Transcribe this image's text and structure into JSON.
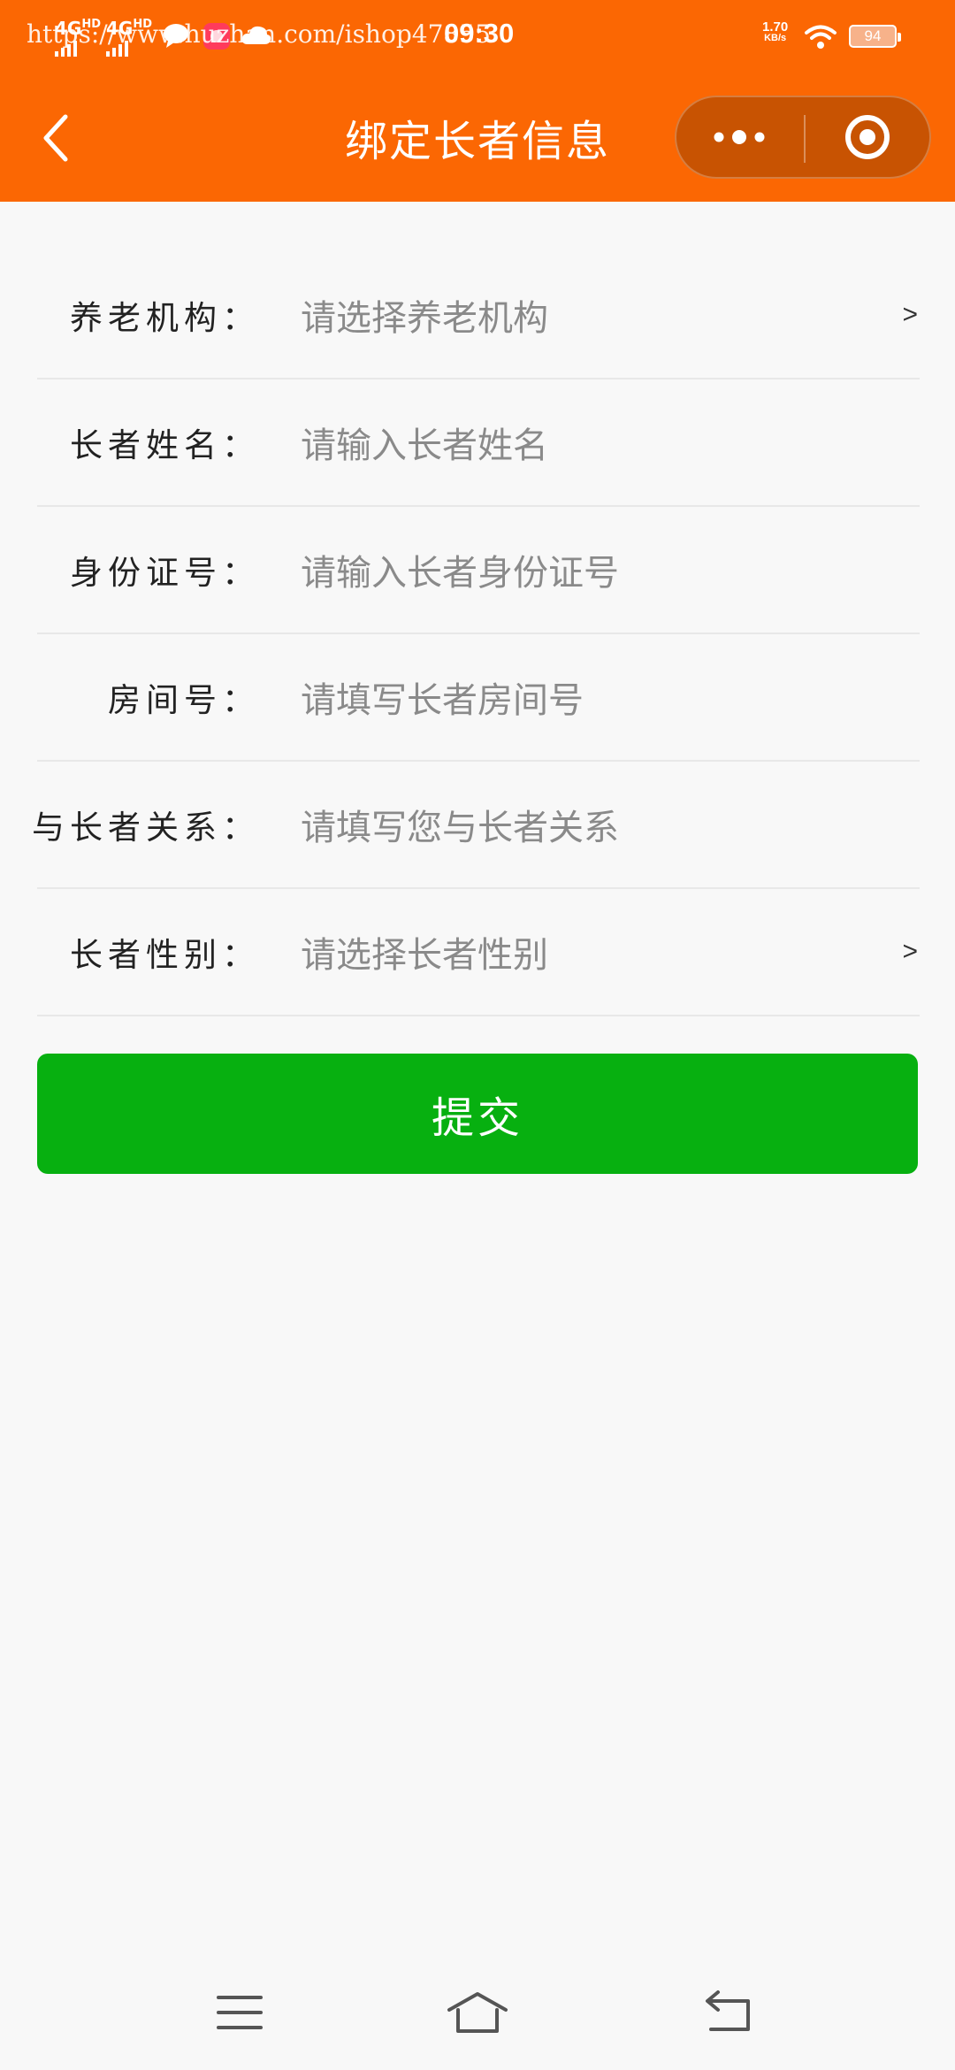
{
  "status_bar": {
    "network_1": "4G",
    "network_1_sup": "HD",
    "network_2": "4G",
    "network_2_sup": "HD",
    "watermark": "https://www.huzhan.com/ishop47855",
    "time": "09:30",
    "net_speed_value": "1.70",
    "net_speed_unit": "KB/s",
    "battery_level": "94"
  },
  "navbar": {
    "title": "绑定长者信息",
    "back_icon": "chevron-left-icon",
    "more_icon": "more-dots-icon",
    "close_icon": "target-circle-icon"
  },
  "form": {
    "rows": [
      {
        "label": "养老机构：",
        "placeholder": "请选择养老机构",
        "chevron": ">"
      },
      {
        "label": "长者姓名：",
        "placeholder": "请输入长者姓名"
      },
      {
        "label": "身份证号：",
        "placeholder": "请输入长者身份证号"
      },
      {
        "label": "房间号：",
        "placeholder": "请填写长者房间号"
      },
      {
        "label": "与长者关系：",
        "placeholder": "请填写您与长者关系"
      },
      {
        "label": "长者性别：",
        "placeholder": "请选择长者性别",
        "chevron": ">"
      }
    ],
    "submit_label": "提交"
  },
  "system_nav": {
    "menu_icon": "menu-icon",
    "home_icon": "home-icon",
    "back_icon": "back-arrow-icon"
  },
  "colors": {
    "header": "#fb6703",
    "capsule": "#c85302",
    "submit": "#07b010",
    "background": "#f8f8f8",
    "placeholder": "#8a8a8a"
  }
}
